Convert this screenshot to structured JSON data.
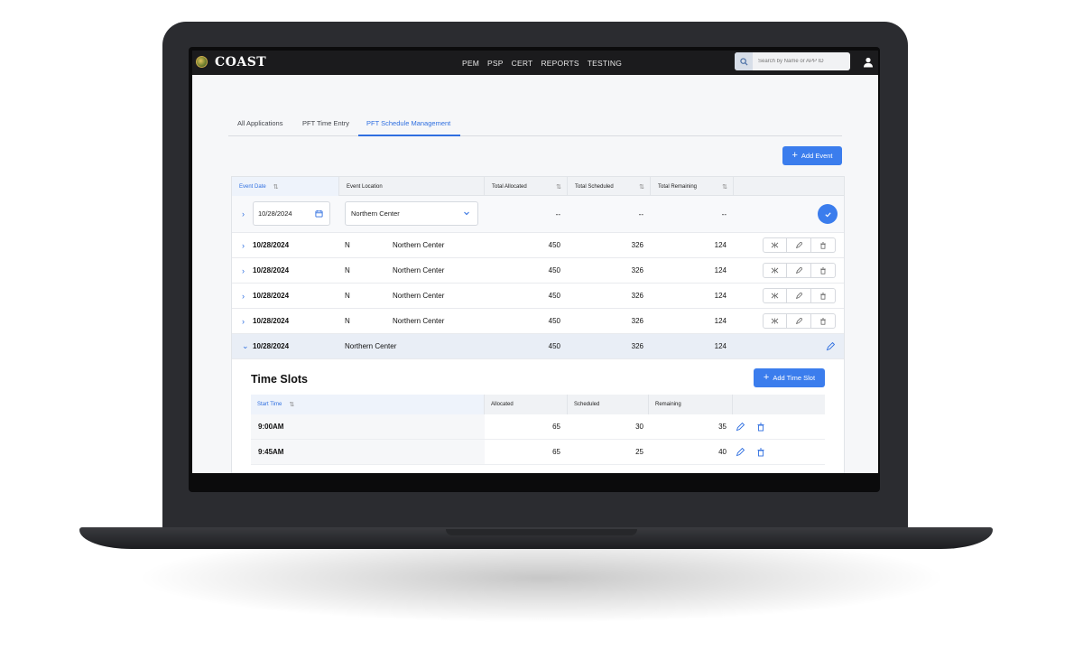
{
  "app": {
    "brand": "COAST",
    "nav": [
      "PEM",
      "PSP",
      "CERT",
      "REPORTS",
      "TESTING"
    ],
    "search_placeholder": "Search by Name or APP ID"
  },
  "tabs": [
    {
      "label": "All Applications",
      "active": false
    },
    {
      "label": "PFT Time Entry",
      "active": false
    },
    {
      "label": "PFT Schedule Management",
      "active": true
    }
  ],
  "add_event_label": "Add Event",
  "table": {
    "headers": {
      "event_date": "Event Date",
      "event_location": "Event Location",
      "total_allocated": "Total  Allocated",
      "total_scheduled": "Total  Scheduled",
      "total_remaining": "Total  Remaining"
    },
    "edit_row": {
      "date": "10/28/2024",
      "location": "Northern Center",
      "allocated": "--",
      "scheduled": "--",
      "remaining": "--"
    },
    "rows": [
      {
        "date": "10/28/2024",
        "code": "N",
        "location": "Northern Center",
        "allocated": "450",
        "scheduled": "326",
        "remaining": "124"
      },
      {
        "date": "10/28/2024",
        "code": "N",
        "location": "Northern Center",
        "allocated": "450",
        "scheduled": "326",
        "remaining": "124"
      },
      {
        "date": "10/28/2024",
        "code": "N",
        "location": "Northern Center",
        "allocated": "450",
        "scheduled": "326",
        "remaining": "124"
      },
      {
        "date": "10/28/2024",
        "code": "N",
        "location": "Northern Center",
        "allocated": "450",
        "scheduled": "326",
        "remaining": "124"
      }
    ],
    "expanded_row": {
      "date": "10/28/2024",
      "location": "Northern Center",
      "allocated": "450",
      "scheduled": "326",
      "remaining": "124"
    }
  },
  "time_slots": {
    "title": "Time Slots",
    "add_label": "Add Time Slot",
    "headers": {
      "start_time": "Start Time",
      "allocated": "Allocated",
      "scheduled": "Scheduled",
      "remaining": "Remaining"
    },
    "rows": [
      {
        "start": "9:00AM",
        "allocated": "65",
        "scheduled": "30",
        "remaining": "35"
      },
      {
        "start": "9:45AM",
        "allocated": "65",
        "scheduled": "25",
        "remaining": "40"
      }
    ]
  },
  "colors": {
    "accent": "#3b7ded",
    "header_bg": "#1b1b1d",
    "frame": "#2b2c30"
  }
}
